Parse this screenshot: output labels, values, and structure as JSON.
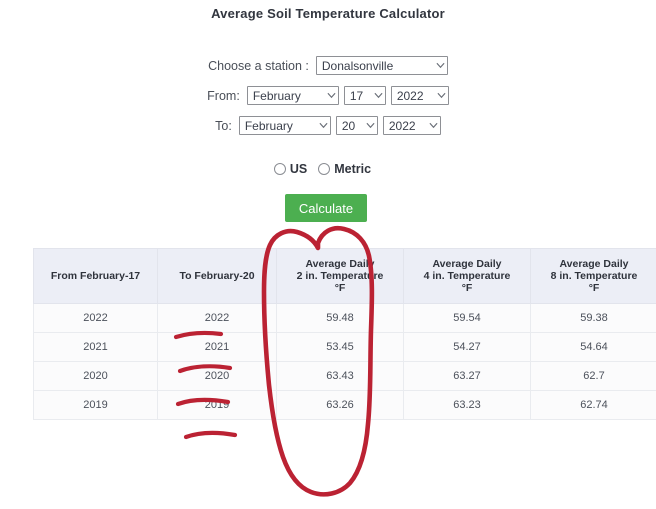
{
  "page": {
    "title": "Average Soil Temperature Calculator"
  },
  "form": {
    "station": {
      "label": "Choose a station :",
      "value": "Donalsonville"
    },
    "from": {
      "label": "From:",
      "month": "February",
      "day": "17",
      "year": "2022"
    },
    "to": {
      "label": "To:",
      "month": "February",
      "day": "20",
      "year": "2022"
    },
    "units": {
      "us_label": "US",
      "metric_label": "Metric",
      "selected": ""
    },
    "calculate_label": "Calculate"
  },
  "table": {
    "headers": [
      "From February-17",
      "To February-20",
      "Average Daily\n2 in. Temperature\n°F",
      "Average Daily\n4 in. Temperature\n°F",
      "Average Daily\n8 in. Temperature\n°F"
    ],
    "header_lines": [
      {
        "l1": "From February-17",
        "l2": "",
        "l3": ""
      },
      {
        "l1": "To February-20",
        "l2": "",
        "l3": ""
      },
      {
        "l1": "Average Daily",
        "l2": "2 in. Temperature",
        "l3": "°F"
      },
      {
        "l1": "Average Daily",
        "l2": "4 in. Temperature",
        "l3": "°F"
      },
      {
        "l1": "Average Daily",
        "l2": "8 in. Temperature",
        "l3": "°F"
      }
    ],
    "rows": [
      {
        "from_year": "2022",
        "to_year": "2022",
        "t2in": "59.48",
        "t4in": "59.54",
        "t8in": "59.38"
      },
      {
        "from_year": "2021",
        "to_year": "2021",
        "t2in": "53.45",
        "t4in": "54.27",
        "t8in": "54.64"
      },
      {
        "from_year": "2020",
        "to_year": "2020",
        "t2in": "63.43",
        "t4in": "63.27",
        "t8in": "62.7"
      },
      {
        "from_year": "2019",
        "to_year": "2019",
        "t2in": "63.26",
        "t4in": "63.23",
        "t8in": "62.74"
      }
    ]
  },
  "annotation": {
    "color": "#bb2233",
    "shapes": "hand-drawn red circle around the '2 in. Temperature' column and four underlines beneath the 'To February-20' year values"
  },
  "colors": {
    "accent_green": "#4caf50",
    "annotation_red": "#bb2233",
    "header_bg": "#eceef6",
    "text": "#3a3f4b"
  }
}
